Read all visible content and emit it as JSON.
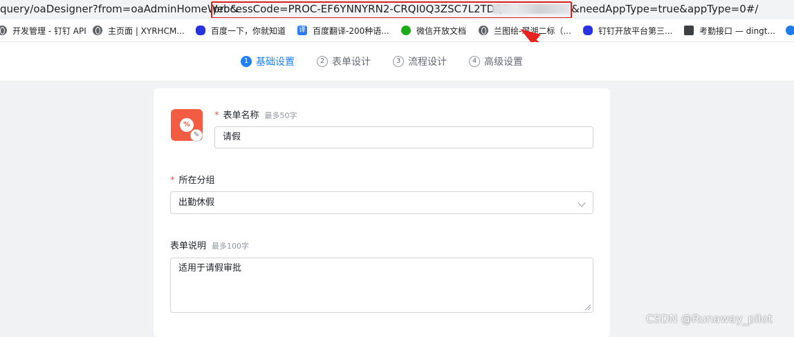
{
  "browser": {
    "url_prefix": "query/oaDesigner?from=oaAdminHomeWeb&",
    "url_highlighted": "processCode=PROC-EF6YNNYRN2-CRQI0Q3ZSC7L2TDQEKO",
    "url_suffix": "&needAppType=true&appType=0#/",
    "highlight_color": "#e02020",
    "bookmarks": [
      {
        "label": "开发管理 - 钉钉 API",
        "icon": "globe-icon"
      },
      {
        "label": "主页面 | XYRHCM...",
        "icon": "globe-icon"
      },
      {
        "label": "百度一下，你就知道",
        "icon": "baidu-icon"
      },
      {
        "label": "百度翻译-200种语...",
        "icon": "baidu-translate-icon",
        "glyph": "译"
      },
      {
        "label": "微信开放文档",
        "icon": "wechat-icon"
      },
      {
        "label": "兰图绘-翠湖二标（...",
        "icon": "globe-icon"
      },
      {
        "label": "钉钉开放平台第三...",
        "icon": "baidu-icon"
      },
      {
        "label": "考勤接口 — dingt...",
        "icon": "book-icon"
      }
    ]
  },
  "steps": [
    {
      "num": "1",
      "label": "基础设置",
      "active": true
    },
    {
      "num": "2",
      "label": "表单设计",
      "active": false
    },
    {
      "num": "3",
      "label": "流程设计",
      "active": false
    },
    {
      "num": "4",
      "label": "高级设置",
      "active": false
    }
  ],
  "form": {
    "icon_color": "#f25c43",
    "icon_glyph": "%",
    "edit_glyph": "✎",
    "required_mark": "*",
    "name_label": "表单名称",
    "name_hint": "最多50字",
    "name_value": "请假",
    "group_label": "所在分组",
    "group_value": "出勤休假",
    "desc_label": "表单说明",
    "desc_hint": "最多100字",
    "desc_value": "适用于请假审批"
  },
  "accent_color": "#1e80ff",
  "watermark": "CSDN @Runaway_pilot"
}
